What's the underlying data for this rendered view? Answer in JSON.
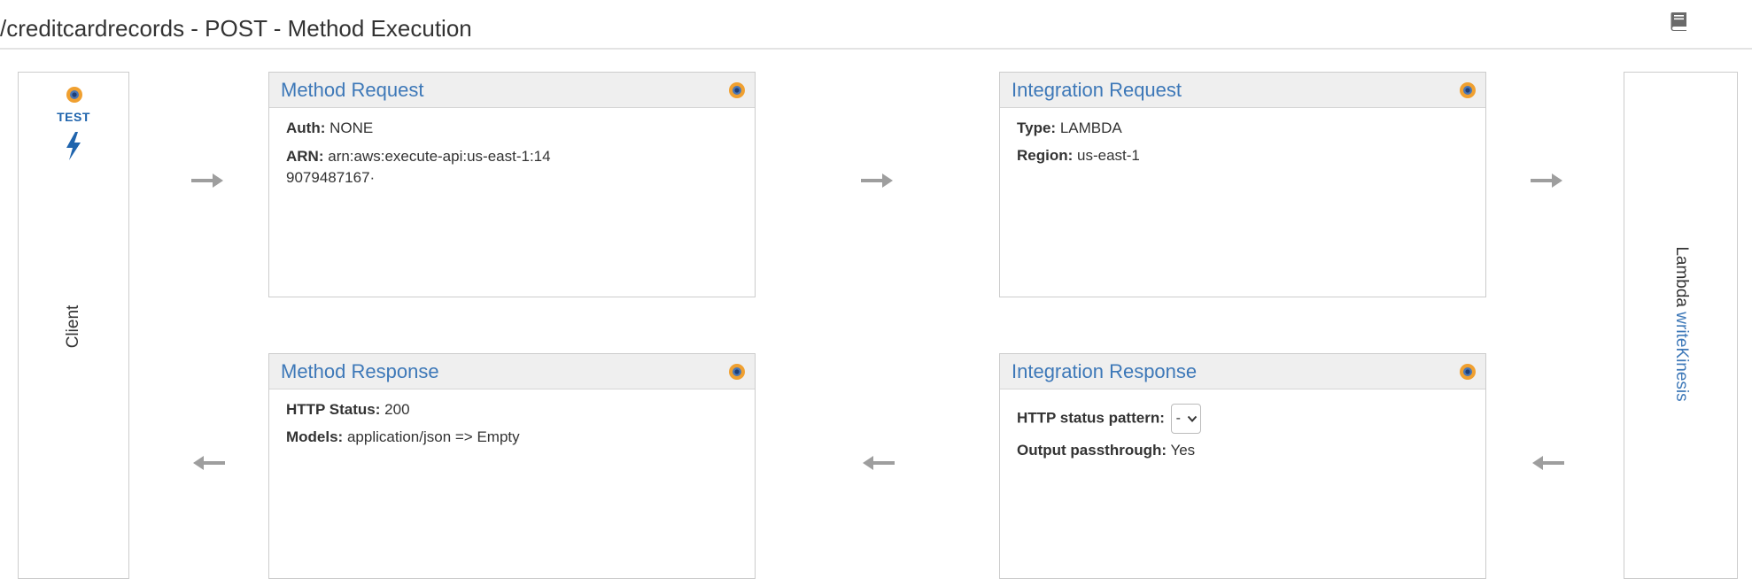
{
  "header": {
    "title": "/creditcardrecords - POST - Method Execution",
    "docs_icon": "book-icon"
  },
  "client": {
    "test_label": "TEST",
    "label": "Client",
    "icons": [
      "settings-dot-icon",
      "lightning-bolt-icon"
    ]
  },
  "method_request": {
    "title": "Method Request",
    "auth_label": "Auth:",
    "auth_value": "NONE",
    "arn_label": "ARN:",
    "arn_value": "arn:aws:execute-api:us-east-1:149079487167·"
  },
  "integration_request": {
    "title": "Integration Request",
    "type_label": "Type:",
    "type_value": "LAMBDA",
    "region_label": "Region:",
    "region_value": "us-east-1"
  },
  "method_response": {
    "title": "Method Response",
    "status_label": "HTTP Status:",
    "status_value": "200",
    "models_label": "Models:",
    "models_value": "application/json => Empty"
  },
  "integration_response": {
    "title": "Integration Response",
    "pattern_label": "HTTP status pattern:",
    "pattern_value": "-",
    "passthrough_label": "Output passthrough:",
    "passthrough_value": "Yes"
  },
  "lambda": {
    "prefix": "Lambda ",
    "function_name": "writeKinesis"
  },
  "colors": {
    "link_blue": "#3d78b8",
    "test_blue": "#1f64ad",
    "dot_orange": "#f0a030",
    "dot_center": "#1f3f78",
    "arrow_gray": "#9e9e9e",
    "panel_header_bg": "#efefef",
    "border_gray": "#cccccc"
  }
}
